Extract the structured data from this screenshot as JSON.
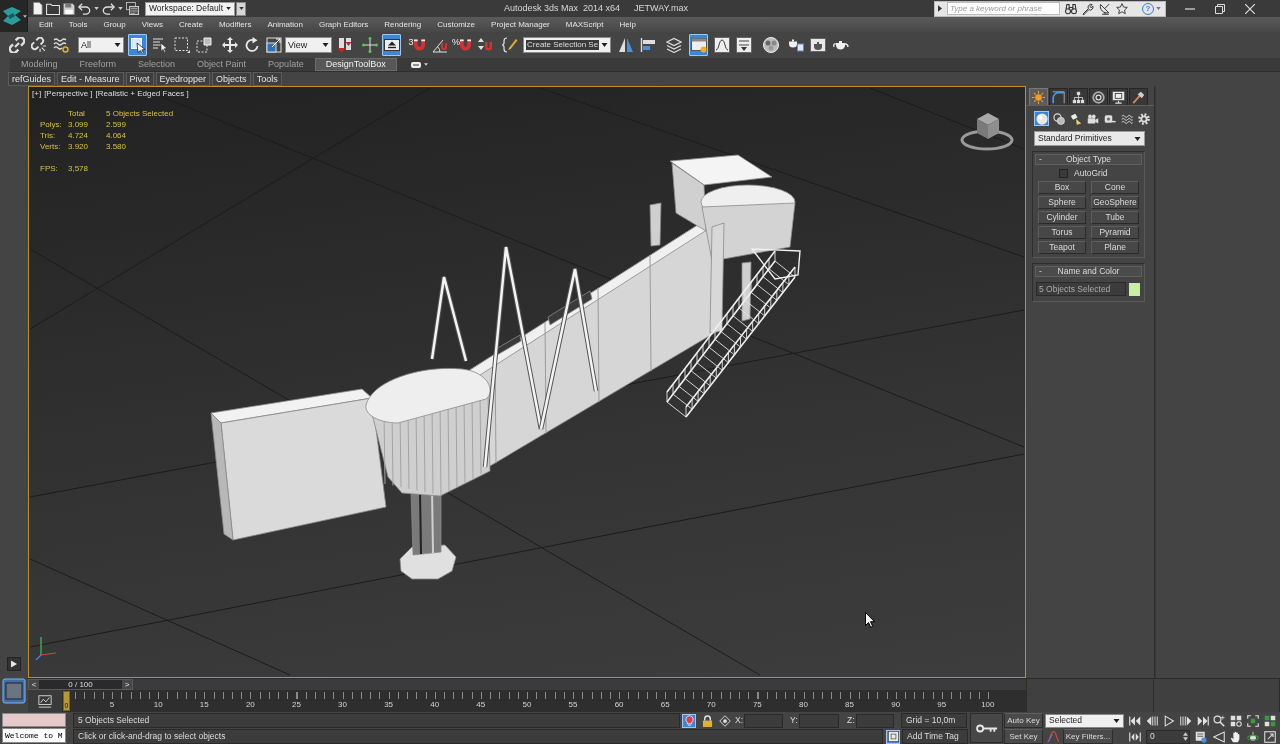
{
  "window": {
    "title": "Autodesk 3ds Max  2014 x64",
    "file": "JETWAY.max",
    "workspace": "Workspace: Default",
    "search_placeholder": "Type a keyword or phrase",
    "help": "?"
  },
  "menu": [
    "Edit",
    "Tools",
    "Group",
    "Views",
    "Create",
    "Modifiers",
    "Animation",
    "Graph Editors",
    "Rendering",
    "Customize",
    "Project Manager",
    "MAXScript",
    "Help"
  ],
  "main_toolbar": [
    {
      "kind": "button",
      "on": false
    },
    {
      "kind": "button",
      "on": false
    },
    {
      "kind": "button",
      "on": false
    },
    {
      "kind": "dropdown",
      "value": "All"
    },
    {
      "kind": "button",
      "on": true
    },
    {
      "kind": "button",
      "on": false
    },
    {
      "kind": "button",
      "on": false
    },
    {
      "kind": "button",
      "on": false
    },
    {
      "kind": "button",
      "on": false
    },
    {
      "kind": "button",
      "on": false
    },
    {
      "kind": "button",
      "on": false
    },
    {
      "kind": "dropdown",
      "value": "View"
    },
    {
      "kind": "button",
      "on": false
    },
    {
      "kind": "button",
      "on": false
    },
    {
      "kind": "button",
      "on": true
    },
    {
      "kind": "button",
      "on": false,
      "glyph": "3"
    },
    {
      "kind": "button",
      "on": false
    },
    {
      "kind": "button",
      "on": false,
      "glyph": "%"
    },
    {
      "kind": "button",
      "on": false
    },
    {
      "kind": "button",
      "on": false
    },
    {
      "kind": "dropdown",
      "value": "Create Selection Se"
    },
    {
      "kind": "button",
      "on": false
    },
    {
      "kind": "button",
      "on": false
    },
    {
      "kind": "button",
      "on": false
    },
    {
      "kind": "button",
      "on": true
    },
    {
      "kind": "button",
      "on": false
    },
    {
      "kind": "button",
      "on": false
    },
    {
      "kind": "button",
      "on": false
    },
    {
      "kind": "button",
      "on": false
    },
    {
      "kind": "button",
      "on": false
    },
    {
      "kind": "button",
      "on": false
    }
  ],
  "ribbon": {
    "tabs": [
      {
        "label": "Modeling",
        "selected": false
      },
      {
        "label": "Freeform",
        "selected": false
      },
      {
        "label": "Selection",
        "selected": false
      },
      {
        "label": "Object Paint",
        "selected": false
      },
      {
        "label": "Populate",
        "selected": false
      },
      {
        "label": "DesignToolBox",
        "selected": true
      }
    ],
    "tools": [
      "refGuides",
      "Edit - Measure",
      "Pivot",
      "Eyedropper",
      "Objects",
      "Tools"
    ]
  },
  "viewport": {
    "labels": [
      "[+]",
      "[Perspective ]",
      "[Realistic + Edged Faces ]"
    ],
    "stats": {
      "headers": [
        "Total",
        "5 Objects Selected"
      ],
      "rows": [
        {
          "label": "Polys:",
          "values": [
            "3.099",
            "2.599"
          ]
        },
        {
          "label": "Tris:",
          "values": [
            "4.724",
            "4.064"
          ]
        },
        {
          "label": "Verts:",
          "values": [
            "3.920",
            "3.580"
          ]
        }
      ],
      "fps": {
        "label": "FPS:",
        "value": "3,578"
      }
    }
  },
  "command_panel": {
    "tabs": [
      {
        "selected": true
      },
      {
        "selected": false
      },
      {
        "selected": false
      },
      {
        "selected": false
      },
      {
        "selected": false
      },
      {
        "selected": false
      }
    ],
    "categories": [
      {
        "selected": true
      },
      {
        "selected": false
      },
      {
        "selected": false
      },
      {
        "selected": false
      },
      {
        "selected": false
      },
      {
        "selected": false
      },
      {
        "selected": false
      }
    ],
    "dropdown": "Standard Primitives",
    "object_type": {
      "toggle": "-",
      "title": "Object Type",
      "autogrid": {
        "label": "AutoGrid",
        "checked": false
      },
      "buttons": [
        "Box",
        "Cone",
        "Sphere",
        "GeoSphere",
        "Cylinder",
        "Tube",
        "Torus",
        "Pyramid",
        "Teapot",
        "Plane"
      ]
    },
    "name_and_color": {
      "toggle": "-",
      "title": "Name and Color",
      "name": "5 Objects Selected",
      "color": "#c6f3a2"
    }
  },
  "timeline": {
    "level": 0,
    "prev": "<",
    "position": "0 / 100",
    "next": ">",
    "marker": "0",
    "ticks": [
      "5",
      "10",
      "15",
      "20",
      "25",
      "30",
      "35",
      "40",
      "45",
      "50",
      "55",
      "60",
      "65",
      "70",
      "75",
      "80",
      "85",
      "90",
      "95",
      "100"
    ]
  },
  "status": {
    "listener": "Welcome to M",
    "selection": "5 Objects Selected",
    "isolate_on": true,
    "coords": [
      "X:",
      "Y:",
      "Z:"
    ],
    "grid": "Grid = 10,0m",
    "prompt": "Click or click-and-drag to select objects",
    "adaptive_on": true,
    "time_tag": "Add Time Tag"
  },
  "animation": {
    "auto_key": "Auto Key",
    "key_mode": "Selected",
    "set_key": "Set Key",
    "key_filters": "Key Filters...",
    "frame": "0"
  }
}
